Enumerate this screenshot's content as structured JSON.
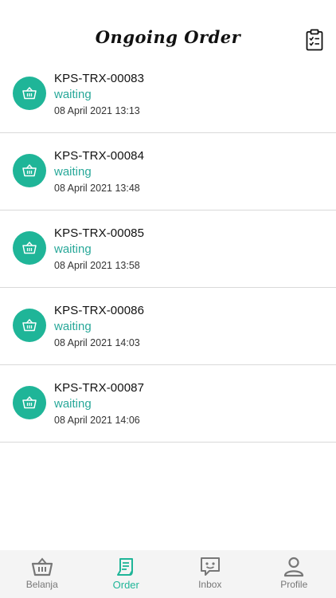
{
  "header": {
    "title": "Ongoing Order",
    "action_icon": "clipboard-checklist-icon"
  },
  "orders": [
    {
      "id": "KPS-TRX-00083",
      "status": "waiting",
      "date": "08 April 2021 13:13",
      "icon": "basket-icon"
    },
    {
      "id": "KPS-TRX-00084",
      "status": "waiting",
      "date": "08 April 2021 13:48",
      "icon": "basket-icon"
    },
    {
      "id": "KPS-TRX-00085",
      "status": "waiting",
      "date": "08 April 2021 13:58",
      "icon": "basket-icon"
    },
    {
      "id": "KPS-TRX-00086",
      "status": "waiting",
      "date": "08 April 2021 14:03",
      "icon": "basket-icon"
    },
    {
      "id": "KPS-TRX-00087",
      "status": "waiting",
      "date": "08 April 2021 14:06",
      "icon": "basket-icon"
    }
  ],
  "bottom_nav": {
    "items": [
      {
        "label": "Belanja",
        "icon": "basket-icon",
        "active": false
      },
      {
        "label": "Order",
        "icon": "receipt-icon",
        "active": true
      },
      {
        "label": "Inbox",
        "icon": "chat-icon",
        "active": false
      },
      {
        "label": "Profile",
        "icon": "user-icon",
        "active": false
      }
    ]
  },
  "colors": {
    "accent": "#1fb598",
    "status_text": "#28a899",
    "nav_background": "#f4f4f4",
    "nav_inactive": "#777777",
    "divider": "#d9d9d9"
  }
}
